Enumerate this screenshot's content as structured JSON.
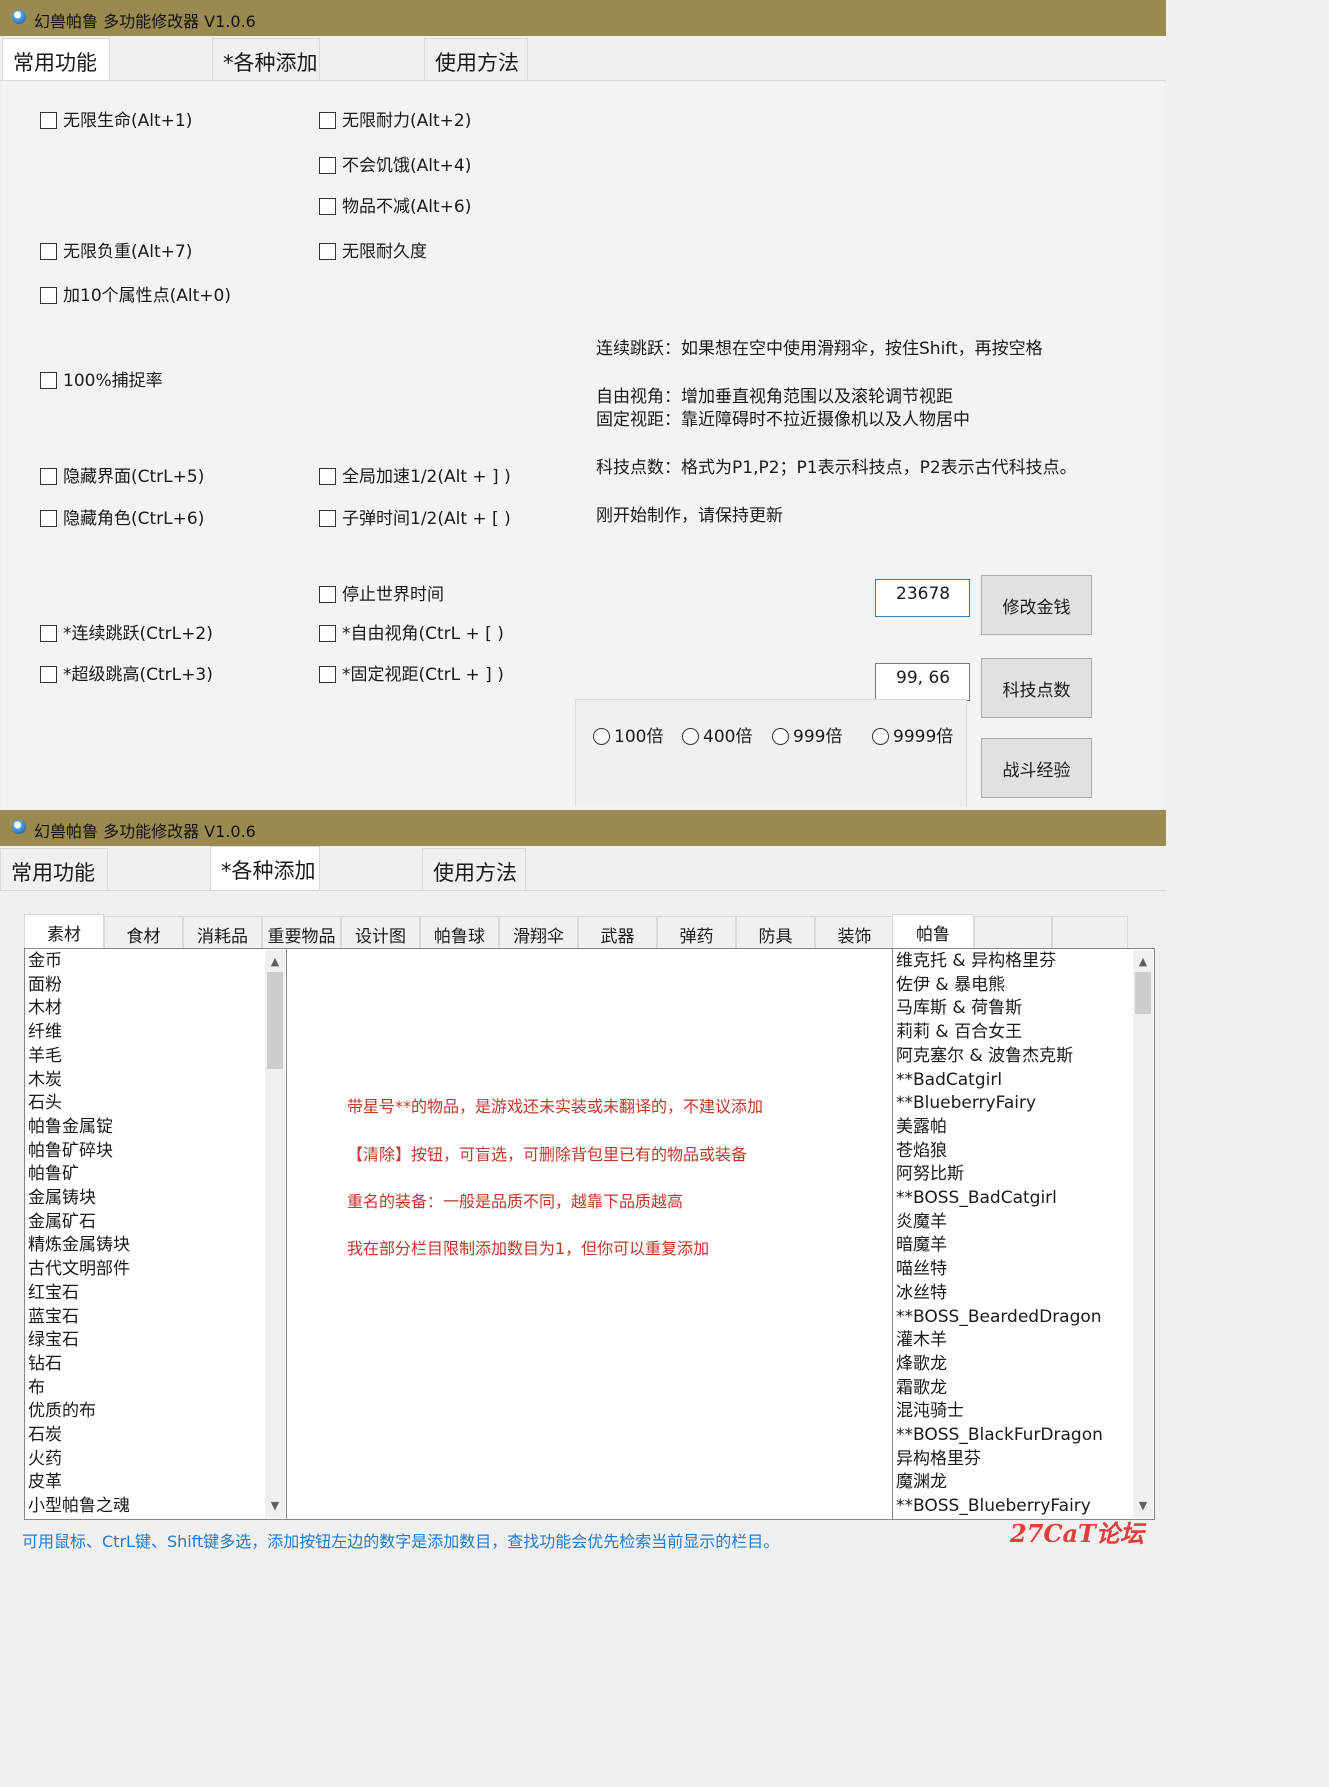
{
  "window": {
    "title": "幻兽帕鲁 多功能修改器 V1.0.6",
    "tabs": [
      "常用功能",
      "*各种添加",
      "使用方法"
    ]
  },
  "common": {
    "checkboxes": [
      "无限生命(Alt+1)",
      "无限耐力(Alt+2)",
      "不会饥饿(Alt+4)",
      "物品不减(Alt+6)",
      "无限负重(Alt+7)",
      "无限耐久度",
      "加10个属性点(Alt+0)",
      "100%捕捉率",
      "隐藏界面(CtrL+5)",
      "全局加速1/2(Alt + ] )",
      "隐藏角色(CtrL+6)",
      "子弹时间1/2(Alt + [ )",
      "停止世界时间",
      "*连续跳跃(CtrL+2)",
      "*自由视角(CtrL + [ )",
      "*超级跳高(CtrL+3)",
      "*固定视距(CtrL + ] )"
    ],
    "notes": [
      "连续跳跃：如果想在空中使用滑翔伞，按住Shift，再按空格",
      "自由视角：增加垂直视角范围以及滚轮调节视距",
      "固定视距：靠近障碍时不拉近摄像机以及人物居中",
      "科技点数：格式为P1,P2；P1表示科技点，P2表示古代科技点。",
      "刚开始制作，请保持更新"
    ],
    "money_value": "23678",
    "money_button": "修改金钱",
    "tech_value": "99, 66",
    "tech_button": "科技点数",
    "multipliers": [
      "100倍",
      "400倍",
      "999倍",
      "9999倍"
    ],
    "exp_button": "战斗经验"
  },
  "add": {
    "subtabs": [
      "素材",
      "食材",
      "消耗品",
      "重要物品",
      "设计图",
      "帕鲁球",
      "滑翔伞",
      "武器",
      "弹药",
      "防具",
      "装饰",
      "帕鲁"
    ],
    "materials": [
      "金币",
      "面粉",
      "木材",
      "纤维",
      "羊毛",
      "木炭",
      "石头",
      "帕鲁金属锭",
      "帕鲁矿碎块",
      "帕鲁矿",
      "金属铸块",
      "金属矿石",
      "精炼金属铸块",
      "古代文明部件",
      "红宝石",
      "蓝宝石",
      "绿宝石",
      "钻石",
      "布",
      "优质的布",
      "石炭",
      "火药",
      "皮革",
      "小型帕鲁之魂"
    ],
    "info": [
      "带星号**的物品，是游戏还未实装或未翻译的，不建议添加",
      "【清除】按钮，可盲选，可删除背包里已有的物品或装备",
      "重名的装备：一般是品质不同，越靠下品质越高",
      "我在部分栏目限制添加数目为1，但你可以重复添加"
    ],
    "pals": [
      "维克托 & 异构格里芬",
      "佐伊 & 暴电熊",
      "马库斯 & 荷鲁斯",
      "莉莉 & 百合女王",
      "阿克塞尔 & 波鲁杰克斯",
      "**BadCatgirl",
      "**BlueberryFairy",
      "美露帕",
      "苍焰狼",
      "阿努比斯",
      "**BOSS_BadCatgirl",
      "炎魔羊",
      "暗魔羊",
      "喵丝特",
      "冰丝特",
      "**BOSS_BeardedDragon",
      "灌木羊",
      "烽歌龙",
      "霜歌龙",
      "混沌骑士",
      "**BOSS_BlackFurDragon",
      "异构格里芬",
      "魔渊龙",
      "**BOSS_BlueberryFairy"
    ],
    "hint": "可用鼠标、CtrL键、Shift键多选，添加按钮左边的数字是添加数目，查找功能会优先检索当前显示的栏目。",
    "watermark": "27CaT论坛"
  },
  "colors": {
    "titlebar": "#9b8a4f",
    "hint": "#1e7bd0",
    "info": "#c0392b",
    "watermark": "#e0403a"
  }
}
